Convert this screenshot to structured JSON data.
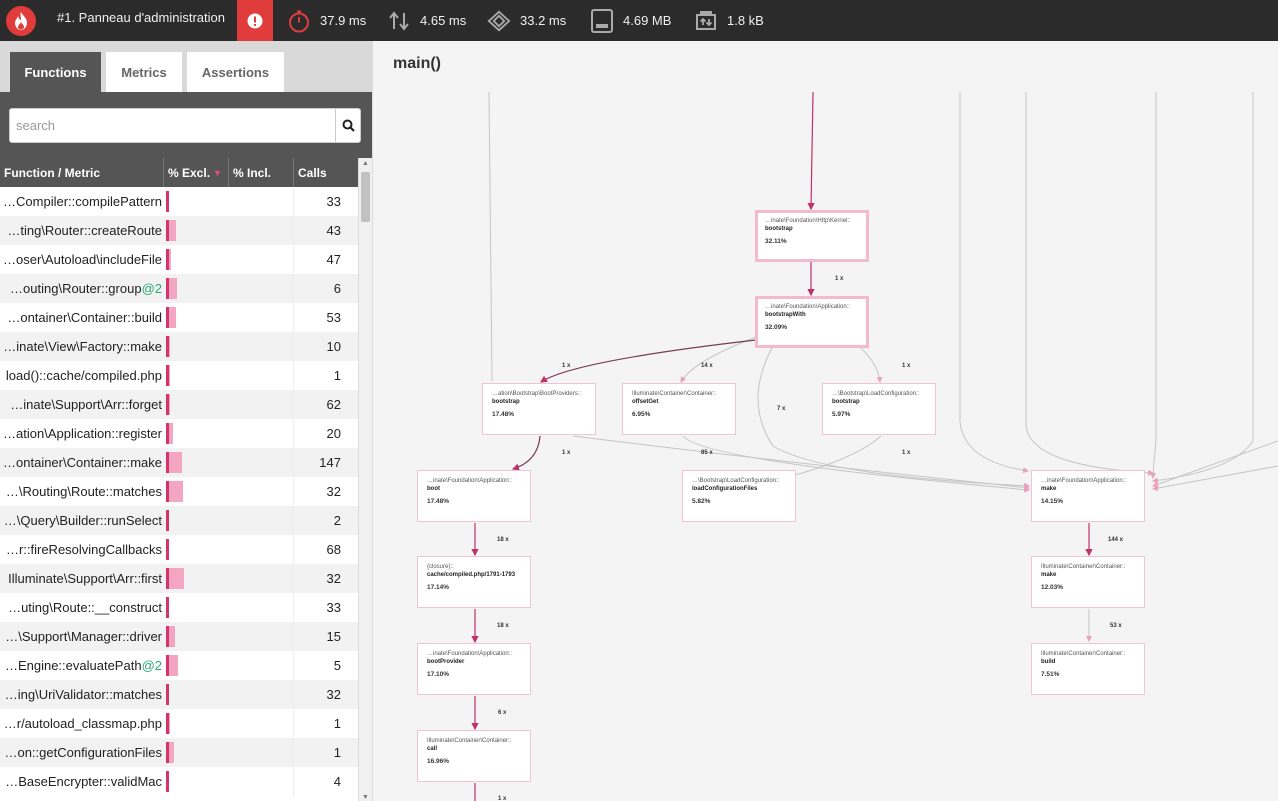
{
  "topbar": {
    "logo_icon": "flame-icon",
    "profile_title": "#1. Panneau d'administration",
    "alert_icon": "alert-icon",
    "metrics": [
      {
        "icon": "stopwatch-icon",
        "value": "37.9 ms"
      },
      {
        "icon": "io-arrows-icon",
        "value": "4.65 ms"
      },
      {
        "icon": "cpu-icon",
        "value": "33.2 ms"
      },
      {
        "icon": "memory-icon",
        "value": "4.69 MB"
      },
      {
        "icon": "network-icon",
        "value": "1.8 kB"
      }
    ]
  },
  "tabs": [
    {
      "label": "Functions",
      "active": true
    },
    {
      "label": "Metrics",
      "active": false
    },
    {
      "label": "Assertions",
      "active": false
    }
  ],
  "search": {
    "placeholder": "search",
    "value": ""
  },
  "table": {
    "columns": [
      "Function / Metric",
      "% Excl.",
      "% Incl.",
      "Calls"
    ],
    "rows": [
      {
        "name": "…Compiler::compilePattern",
        "suffix": "",
        "excl": 0.02,
        "calls": "33"
      },
      {
        "name": "…ting\\Router::createRoute",
        "suffix": "",
        "excl": 0.45,
        "calls": "43"
      },
      {
        "name": "…oser\\Autoload\\includeFile",
        "suffix": "",
        "excl": 0.1,
        "calls": "47"
      },
      {
        "name": "…outing\\Router::group",
        "suffix": "@2",
        "excl": 0.5,
        "calls": "6"
      },
      {
        "name": "…ontainer\\Container::build",
        "suffix": "",
        "excl": 0.45,
        "calls": "53"
      },
      {
        "name": "…inate\\View\\Factory::make",
        "suffix": "",
        "excl": 0.05,
        "calls": "10"
      },
      {
        "name": "load()::cache/compiled.php",
        "suffix": "",
        "excl": 0.05,
        "calls": "1"
      },
      {
        "name": "…inate\\Support\\Arr::forget",
        "suffix": "",
        "excl": 0.05,
        "calls": "62"
      },
      {
        "name": "…ation\\Application::register",
        "suffix": "",
        "excl": 0.25,
        "calls": "20"
      },
      {
        "name": "…ontainer\\Container::make",
        "suffix": "",
        "excl": 0.85,
        "calls": "147"
      },
      {
        "name": "…\\Routing\\Route::matches",
        "suffix": "",
        "excl": 0.9,
        "calls": "32"
      },
      {
        "name": "…\\Query\\Builder::runSelect",
        "suffix": "",
        "excl": 0.02,
        "calls": "2"
      },
      {
        "name": "…r::fireResolvingCallbacks",
        "suffix": "",
        "excl": 0.02,
        "calls": "68"
      },
      {
        "name": "Illuminate\\Support\\Arr::first",
        "suffix": "",
        "excl": 1.0,
        "calls": "32"
      },
      {
        "name": "…uting\\Route::__construct",
        "suffix": "",
        "excl": 0.02,
        "calls": "33"
      },
      {
        "name": "…\\Support\\Manager::driver",
        "suffix": "",
        "excl": 0.4,
        "calls": "15"
      },
      {
        "name": "…Engine::evaluatePath",
        "suffix": "@2",
        "excl": 0.6,
        "calls": "5"
      },
      {
        "name": "…ing\\UriValidator::matches",
        "suffix": "",
        "excl": 0.02,
        "calls": "32"
      },
      {
        "name": "…r/autoload_classmap.php",
        "suffix": "",
        "excl": 0.05,
        "calls": "1"
      },
      {
        "name": "…on::getConfigurationFiles",
        "suffix": "",
        "excl": 0.35,
        "calls": "1"
      },
      {
        "name": "…BaseEncrypter::validMac",
        "suffix": "",
        "excl": 0.02,
        "calls": "4"
      }
    ]
  },
  "graph": {
    "title": "main()",
    "nodes": [
      {
        "id": "kernel-bootstrap",
        "ns": "…inate\\Foundation\\Http\\Kernel::",
        "fn": "bootstrap",
        "pct": "32.11%",
        "hot": true
      },
      {
        "id": "app-bootstrapwith",
        "ns": "…inate\\Foundation\\Application::",
        "fn": "bootstrapWith",
        "pct": "32.09%",
        "hot": true
      },
      {
        "id": "bootproviders-bootstrap",
        "ns": "…ation\\Bootstrap\\BootProviders::",
        "fn": "bootstrap",
        "pct": "17.48%",
        "hot": false
      },
      {
        "id": "container-offsetget",
        "ns": "Illuminate\\Container\\Container::",
        "fn": "offsetGet",
        "pct": "6.95%",
        "hot": false
      },
      {
        "id": "loadconfiguration-bootstrap",
        "ns": "…\\Bootstrap\\LoadConfiguration::",
        "fn": "bootstrap",
        "pct": "5.97%",
        "hot": false
      },
      {
        "id": "app-boot",
        "ns": "…inate\\Foundation\\Application::",
        "fn": "boot",
        "pct": "17.48%",
        "hot": false
      },
      {
        "id": "loadconfigurationfiles",
        "ns": "…\\Bootstrap\\LoadConfiguration::",
        "fn": "loadConfigurationFiles",
        "pct": "5.82%",
        "hot": false
      },
      {
        "id": "app-make",
        "ns": "…inate\\Foundation\\Application::",
        "fn": "make",
        "pct": "14.15%",
        "hot": false
      },
      {
        "id": "closure-compiled",
        "ns": "{closure}::",
        "fn": "cache/compiled.php/1791-1793",
        "pct": "17.14%",
        "hot": false
      },
      {
        "id": "container-make",
        "ns": "Illuminate\\Container\\Container::",
        "fn": "make",
        "pct": "12.03%",
        "hot": false
      },
      {
        "id": "app-bootprovider",
        "ns": "…inate\\Foundation\\Application::",
        "fn": "bootProvider",
        "pct": "17.10%",
        "hot": false
      },
      {
        "id": "container-build",
        "ns": "Illuminate\\Container\\Container::",
        "fn": "build",
        "pct": "7.51%",
        "hot": false
      },
      {
        "id": "container-call",
        "ns": "Illuminate\\Container\\Container::",
        "fn": "call",
        "pct": "16.96%",
        "hot": false
      }
    ],
    "edge_labels": [
      "1 x",
      "1 x",
      "14 x",
      "7 x",
      "1 x",
      "1 x",
      "85 x",
      "1 x",
      "18 x",
      "144 x",
      "18 x",
      "53 x",
      "6 x",
      "1 x"
    ]
  }
}
